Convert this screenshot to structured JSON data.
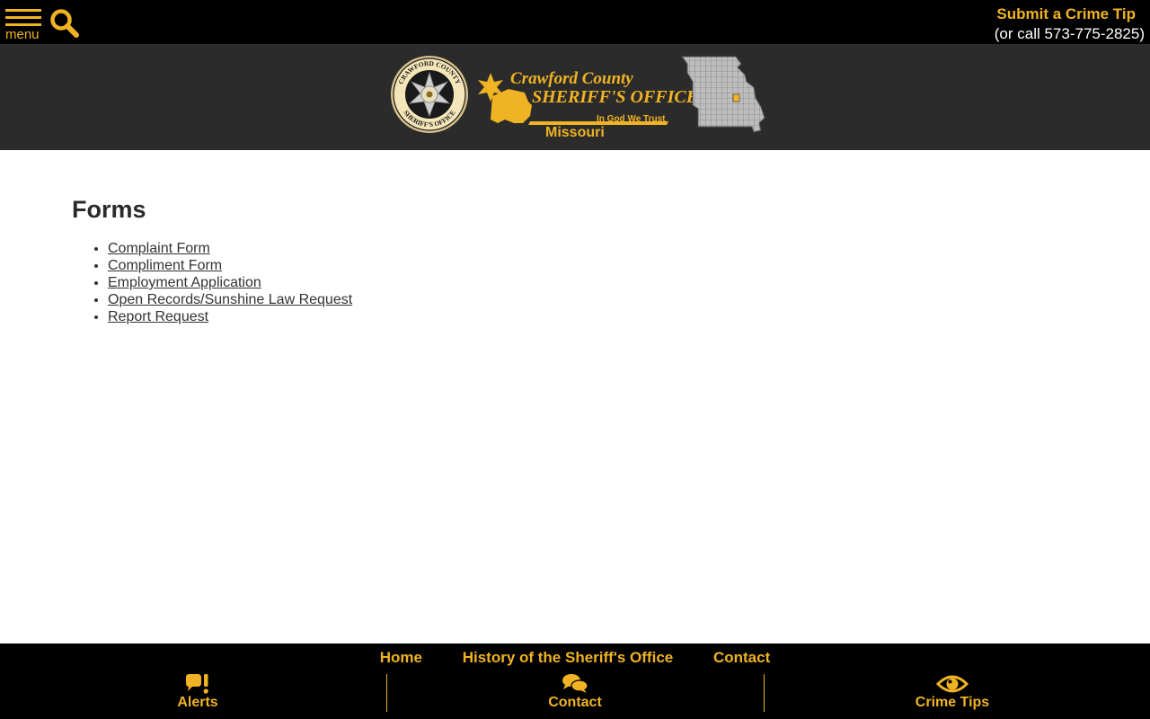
{
  "header": {
    "menu_label": "menu",
    "tip_link": "Submit a Crime Tip",
    "tip_phone": "(or call 573-775-2825)"
  },
  "banner": {
    "badge_ring_top": "CRAWFORD COUNTY",
    "badge_ring_bottom": "SHERIFF'S OFFICE",
    "logo_county": "Crawford County",
    "logo_office": "SHERIFF'S OFFICE",
    "logo_motto": "In God We Trust",
    "logo_state": "Missouri"
  },
  "main": {
    "title": "Forms",
    "forms": [
      {
        "label": "Complaint Form"
      },
      {
        "label": "Compliment Form"
      },
      {
        "label": "Employment Application"
      },
      {
        "label": "Open Records/Sunshine Law Request"
      },
      {
        "label": "Report Request"
      }
    ]
  },
  "footer": {
    "nav": [
      {
        "label": "Home"
      },
      {
        "label": "History of the Sheriff's Office"
      },
      {
        "label": "Contact"
      }
    ],
    "buttons": [
      {
        "label": "Alerts",
        "icon": "alert-bubble-icon"
      },
      {
        "label": "Contact",
        "icon": "chat-bubbles-icon"
      },
      {
        "label": "Crime Tips",
        "icon": "eye-icon"
      }
    ]
  },
  "colors": {
    "accent": "#f0b323",
    "banner_bg": "#2b2b2b",
    "bar_bg": "#000000"
  }
}
